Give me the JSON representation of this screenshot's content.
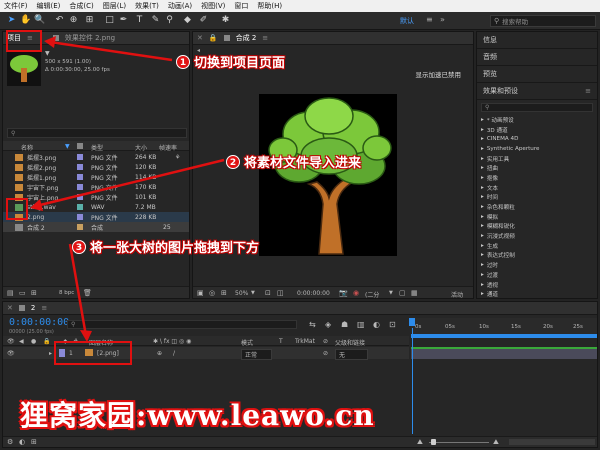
{
  "menu": [
    "文件(F)",
    "编辑(E)",
    "合成(C)",
    "图层(L)",
    "效果(T)",
    "动画(A)",
    "视图(V)",
    "窗口",
    "帮助(H)"
  ],
  "toolbar": {
    "workspace_label": "默认",
    "search_placeholder": "搜索帮助"
  },
  "project_panel": {
    "tab_label": "项目",
    "effects_tab_label": "效果控件 2.png",
    "thumb_info_line1": "500 x 591 (1.00)",
    "thumb_info_line2": "Δ 0:00:30:00, 25.00 fps",
    "search_placeholder": "",
    "columns": [
      "名称",
      "类型",
      "大小",
      "帧速率"
    ],
    "files": [
      {
        "name": "摇摆3.png",
        "type": "PNG 文件",
        "size": "264 KB",
        "fps": ""
      },
      {
        "name": "摇摆2.png",
        "type": "PNG 文件",
        "size": "120 KB",
        "fps": ""
      },
      {
        "name": "摇摆1.png",
        "type": "PNG 文件",
        "size": "114 KB",
        "fps": ""
      },
      {
        "name": "宇宙下.png",
        "type": "PNG 文件",
        "size": "170 KB",
        "fps": ""
      },
      {
        "name": "宇宙上.png",
        "type": "PNG 文件",
        "size": "101 KB",
        "fps": ""
      },
      {
        "name": "sting.wav",
        "type": "WAV",
        "size": "7.2 MB",
        "fps": ""
      },
      {
        "name": "2.png",
        "type": "PNG 文件",
        "size": "228 KB",
        "fps": ""
      },
      {
        "name": "合成 2",
        "type": "合成",
        "size": "",
        "fps": "25"
      }
    ],
    "bpc": "8 bpc"
  },
  "composition": {
    "tab_label": "合成 2",
    "gpu_notice": "显示加速已禁用",
    "zoom": "50%",
    "timecode": "0:00:00:00",
    "resolution": "(二分",
    "active_label": "活动"
  },
  "right_panel": {
    "sections": [
      "信息",
      "音频",
      "预览",
      "效果和预设"
    ],
    "effects_search_placeholder": "",
    "effects": [
      "* 动画预设",
      "3D 通道",
      "CINEMA 4D",
      "Synthetic Aperture",
      "实用工具",
      "扭曲",
      "抠像",
      "文本",
      "时间",
      "杂色和颗粒",
      "模拟",
      "模糊和锐化",
      "沉浸式视频",
      "生成",
      "表达式控制",
      "过时",
      "过渡",
      "透视",
      "通道"
    ]
  },
  "timeline": {
    "tab_label": "2",
    "timecode": "0:00:00:00",
    "fps_line": "00000 (25.00 fps)",
    "columns": [
      "图层名称",
      "模式",
      "T",
      "TrkMat",
      "父级和链接"
    ],
    "layer": {
      "index": "1",
      "name": "[2.png]",
      "mode": "正常",
      "parent": "无"
    },
    "ruler": [
      "0s",
      "05s",
      "10s",
      "15s",
      "20s",
      "25s"
    ]
  },
  "annotations": [
    {
      "num": "1",
      "text": "切换到项目页面"
    },
    {
      "num": "2",
      "text": "将素材文件导入进来"
    },
    {
      "num": "3",
      "text": "将一张大树的图片拖拽到下方"
    }
  ],
  "watermark": "狸窝家园:www.leawo.cn",
  "colors": {
    "accent_blue": "#2d8ceb",
    "annotation_red": "#e01010",
    "timecode_blue": "#2d8ceb",
    "tree_green": "#7cc83a",
    "trunk_brown": "#c07028"
  }
}
